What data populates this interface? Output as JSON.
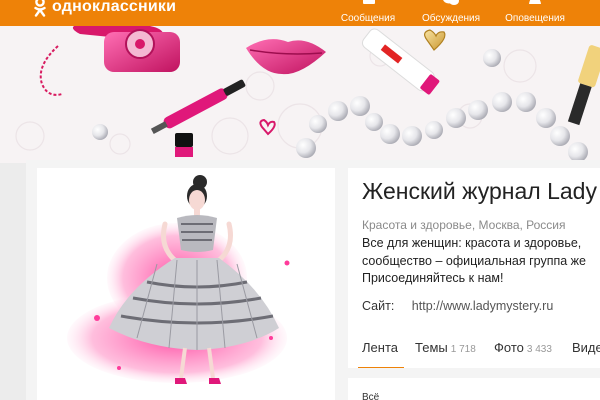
{
  "header": {
    "logo_text": "одноклассники",
    "nav": [
      {
        "label": "Сообщения",
        "icon": "message-icon"
      },
      {
        "label": "Обсуждения",
        "icon": "discussions-icon"
      },
      {
        "label": "Оповещения",
        "icon": "notifications-icon"
      }
    ]
  },
  "group": {
    "title": "Женский журнал Lady",
    "meta": "Красота и здоровье, Москва, Россия",
    "description_lines": [
      "Все для женщин: красота и здоровье,",
      "сообщество – официальная группа же",
      "Присоединяйтесь к нам!"
    ],
    "site_label": "Сайт:",
    "site_url": "http://www.ladymystery.ru"
  },
  "tabs": [
    {
      "label": "Лента",
      "count": ""
    },
    {
      "label": "Темы",
      "count": "1 718"
    },
    {
      "label": "Фото",
      "count": "3 433"
    },
    {
      "label": "Виде",
      "count": ""
    }
  ],
  "feed": {
    "filter_label": "Всё"
  },
  "colors": {
    "brand": "#ee8208",
    "background": "#ececec",
    "accent_pink": "#e8156e"
  }
}
